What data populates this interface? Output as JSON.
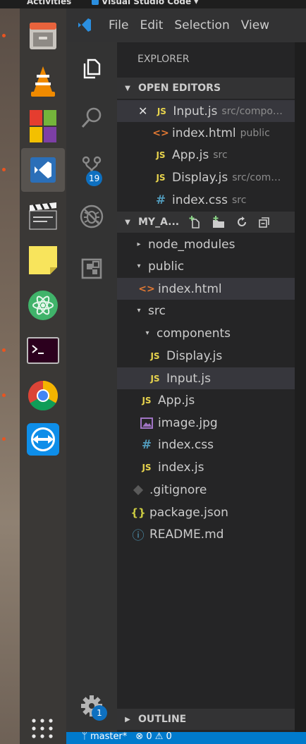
{
  "topbar": {
    "activities": "Activities",
    "app_name": "Visual Studio Code ▾"
  },
  "dock": {
    "items": [
      {
        "name": "files-icon"
      },
      {
        "name": "vlc-icon"
      },
      {
        "name": "software-center-icon"
      },
      {
        "name": "vscode-icon"
      },
      {
        "name": "video-editor-icon"
      },
      {
        "name": "sticky-notes-icon"
      },
      {
        "name": "atom-icon"
      },
      {
        "name": "terminal-icon"
      },
      {
        "name": "chrome-icon"
      },
      {
        "name": "teamviewer-icon"
      }
    ],
    "show_apps_label": ":::"
  },
  "menubar": {
    "items": [
      "File",
      "Edit",
      "Selection",
      "View"
    ]
  },
  "activity_bar": {
    "scm_badge": "19",
    "settings_badge": "1"
  },
  "explorer": {
    "title": "EXPLORER",
    "open_editors": {
      "header": "OPEN EDITORS",
      "items": [
        {
          "icon": "JS",
          "name": "Input.js",
          "desc": "src/compo…"
        },
        {
          "icon": "<>",
          "name": "index.html",
          "desc": "public"
        },
        {
          "icon": "JS",
          "name": "App.js",
          "desc": "src"
        },
        {
          "icon": "JS",
          "name": "Display.js",
          "desc": "src/com…"
        },
        {
          "icon": "#",
          "name": "index.css",
          "desc": "src"
        }
      ]
    },
    "project": {
      "header": "MY_A...",
      "tree": [
        {
          "label": "node_modules",
          "arrow": "▸"
        },
        {
          "label": "public",
          "arrow": "▾"
        },
        {
          "label": "index.html",
          "icon": "<>"
        },
        {
          "label": "src",
          "arrow": "▾"
        },
        {
          "label": "components",
          "arrow": "▾"
        },
        {
          "label": "Display.js",
          "icon": "JS"
        },
        {
          "label": "Input.js",
          "icon": "JS"
        },
        {
          "label": "App.js",
          "icon": "JS"
        },
        {
          "label": "image.jpg",
          "icon": "img"
        },
        {
          "label": "index.css",
          "icon": "#"
        },
        {
          "label": "index.js",
          "icon": "JS"
        },
        {
          "label": ".gitignore",
          "icon": "git"
        },
        {
          "label": "package.json",
          "icon": "{}"
        },
        {
          "label": "README.md",
          "icon": "ⓘ"
        }
      ]
    },
    "outline": {
      "header": "OUTLINE"
    }
  },
  "statusbar": {
    "branch": "master*",
    "errors": "0",
    "warnings": "0"
  },
  "colors": {
    "accent": "#007acc",
    "badge": "#0e70c0",
    "js": "#e8d44d",
    "html": "#e37933",
    "css": "#519aba",
    "ubuntu_orange": "#e95420"
  }
}
